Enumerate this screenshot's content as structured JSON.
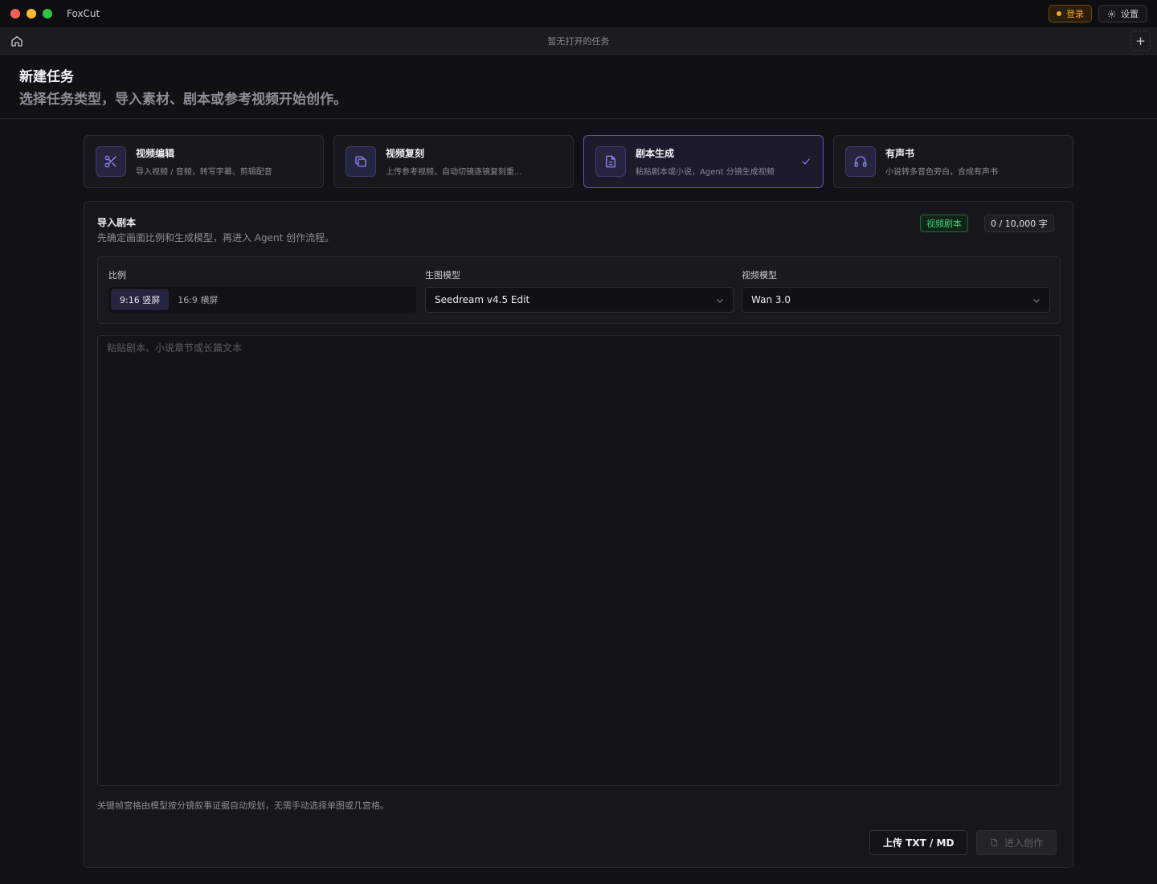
{
  "app": {
    "name": "FoxCut"
  },
  "titlebar": {
    "login_label": "登录",
    "settings_label": "设置"
  },
  "tabbar": {
    "empty_text": "暂无打开的任务",
    "add_label": "+"
  },
  "header": {
    "title": "新建任务",
    "subtitle": "选择任务类型，导入素材、剧本或参考视频开始创作。"
  },
  "task_types": [
    {
      "icon": "scissors-icon",
      "title": "视频编辑",
      "desc": "导入视频 / 音频，转写字幕、剪辑配音",
      "selected": false
    },
    {
      "icon": "copy-icon",
      "title": "视频复刻",
      "desc": "上传参考视频，自动切镜逐镜复刻重...",
      "selected": false
    },
    {
      "icon": "document-icon",
      "title": "剧本生成",
      "desc": "粘贴剧本或小说，Agent 分镜生成视频",
      "selected": true
    },
    {
      "icon": "headphones-icon",
      "title": "有声书",
      "desc": "小说转多音色旁白，合成有声书",
      "selected": false
    }
  ],
  "panel": {
    "title": "导入剧本",
    "desc": "先确定画面比例和生成模型，再进入 Agent 创作流程。",
    "badge_type": "视频剧本",
    "char_count": "0 / 10,000 字",
    "ratio_label": "比例",
    "ratio_options": [
      "9:16 竖屏",
      "16:9 横屏"
    ],
    "ratio_selected": "9:16 竖屏",
    "image_model_label": "生图模型",
    "image_model_value": "Seedream v4.5 Edit",
    "video_model_label": "视频模型",
    "video_model_value": "Wan 3.0",
    "script_placeholder": "粘贴剧本、小说章节或长篇文本",
    "script_value": "",
    "footer_note": "关键帧宫格由模型按分镜叙事证据自动规划，无需手动选择单图或几宫格。",
    "upload_label": "上传 TXT / MD",
    "enter_label": "进入创作"
  },
  "colors": {
    "accent": "#5d55b5",
    "login": "#f5a623",
    "badge_green": "#3ecf72"
  }
}
